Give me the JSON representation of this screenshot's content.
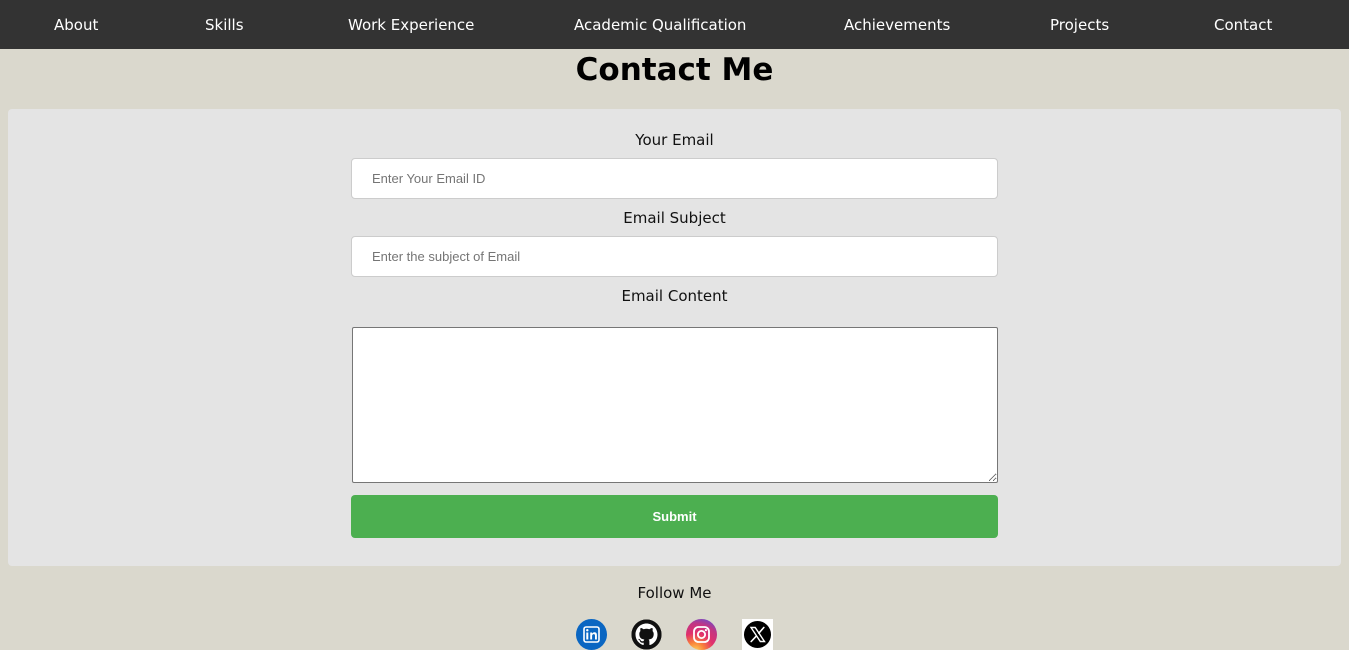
{
  "nav": {
    "about": "About",
    "skills": "Skills",
    "work": "Work Experience",
    "academic": "Academic Qualification",
    "achievements": "Achievements",
    "projects": "Projects",
    "contact": "Contact"
  },
  "page_title": "Contact Me",
  "form": {
    "email_label": "Your Email",
    "email_placeholder": "Enter Your Email ID",
    "email_value": "",
    "subject_label": "Email Subject",
    "subject_placeholder": "Enter the subject of Email",
    "subject_value": "",
    "content_label": "Email Content",
    "content_value": "",
    "submit_label": "Submit"
  },
  "follow": {
    "title": "Follow Me",
    "icons": [
      "linkedin-icon",
      "github-icon",
      "instagram-icon",
      "x-icon"
    ]
  },
  "colors": {
    "navbar_bg": "#333333",
    "page_bg": "#dad8cd",
    "card_bg": "#e4e4e4",
    "submit_bg": "#4caf50",
    "linkedin": "#0a66c2"
  }
}
